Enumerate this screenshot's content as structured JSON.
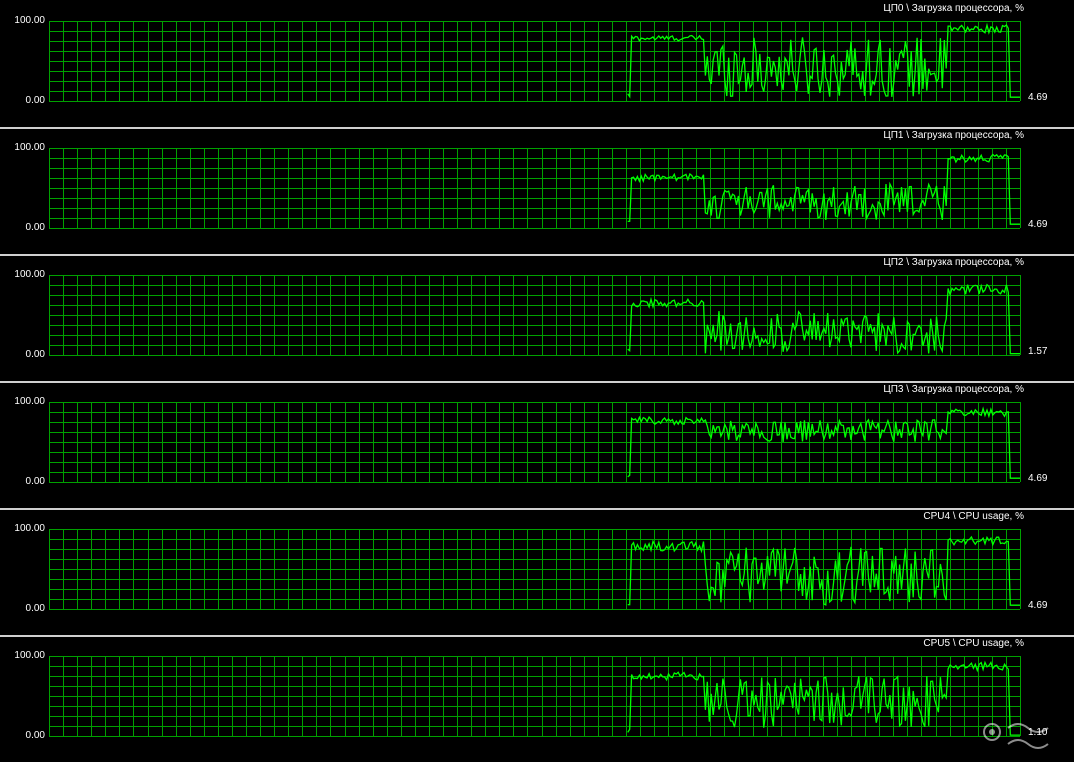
{
  "chart_data": [
    {
      "type": "line",
      "title": "ЦП0 \\ Загрузка процессора, %",
      "ylim": [
        0,
        100
      ],
      "ymax_label": "100.00",
      "ymin_label": "0.00",
      "current_value": "4.69",
      "series": [
        {
          "values": [
            5,
            5,
            5,
            5,
            5,
            5,
            5,
            5,
            5,
            5,
            5,
            5,
            5,
            5,
            5,
            5,
            5,
            5,
            5,
            5,
            5,
            5,
            5,
            5,
            5,
            5,
            5,
            5,
            5,
            5,
            5,
            5,
            5,
            5,
            5,
            5,
            5,
            5,
            5,
            5,
            5,
            5,
            5,
            5,
            5,
            5,
            5,
            5,
            5,
            5,
            5,
            5,
            5,
            5,
            5,
            5,
            5,
            5,
            5,
            5,
            5,
            5,
            5,
            5,
            5,
            5,
            5,
            5,
            5,
            5,
            5,
            5,
            5,
            5,
            5,
            5,
            5,
            5,
            5,
            5,
            5,
            5,
            5,
            5,
            5,
            5,
            5,
            5,
            5,
            5,
            5,
            5,
            5,
            5,
            5,
            5,
            5,
            5,
            5,
            5,
            5,
            5,
            5,
            5,
            5,
            5,
            5,
            5,
            5,
            5,
            5,
            5,
            5,
            5,
            5,
            5,
            5,
            5,
            5,
            5,
            5,
            5,
            5,
            5,
            5,
            5,
            5,
            5,
            5,
            5,
            5,
            5,
            5,
            5,
            5,
            5,
            5,
            5,
            5,
            5,
            5,
            5,
            5,
            5,
            5,
            5,
            5,
            5,
            5,
            5,
            5,
            5,
            5,
            5,
            5,
            5,
            5,
            5,
            5,
            5,
            5,
            5,
            5,
            5,
            5,
            5,
            5,
            5,
            5,
            5,
            5,
            5,
            5,
            5,
            5,
            5,
            5,
            5,
            5,
            5,
            5,
            5,
            5,
            5,
            5,
            5,
            5,
            5,
            5,
            5,
            5,
            5,
            5,
            5,
            5,
            5,
            5,
            5,
            5,
            5,
            5,
            5,
            5,
            5,
            5,
            5,
            5,
            5,
            5,
            5,
            5,
            5,
            5,
            5,
            5,
            5,
            5,
            5,
            5,
            5,
            5,
            5,
            5,
            5,
            5,
            5,
            5,
            5,
            5,
            5,
            5,
            5,
            5,
            5,
            5,
            5,
            5,
            5,
            5,
            5,
            5,
            5,
            5,
            5,
            5,
            5,
            5,
            5,
            5,
            5,
            5,
            5,
            5,
            5,
            5,
            5,
            5,
            5,
            5,
            5,
            5,
            5,
            5,
            5,
            5,
            5,
            5,
            5,
            5,
            5,
            5,
            5,
            5,
            5,
            5,
            5,
            5,
            5,
            5,
            5,
            5,
            5,
            5,
            5,
            5,
            5,
            5,
            5,
            5,
            5,
            5,
            5,
            5,
            5,
            5,
            5,
            5,
            5,
            5,
            5,
            5,
            5,
            5,
            5,
            5,
            5,
            5,
            5,
            5,
            5,
            5,
            5,
            5,
            5,
            5,
            5,
            5,
            5,
            5,
            5,
            5,
            5,
            5,
            5,
            5,
            5,
            5,
            5,
            5,
            5,
            5,
            5,
            5,
            5,
            5,
            5,
            5,
            5,
            5,
            5,
            5,
            5,
            5,
            5,
            5,
            5,
            5,
            5,
            5,
            5,
            5,
            5,
            5,
            5,
            5,
            5,
            5,
            5,
            5,
            5,
            5,
            5,
            5,
            5,
            5,
            5,
            5,
            5,
            5,
            5,
            5,
            5,
            5,
            5,
            5,
            5,
            5,
            5,
            5,
            5,
            5,
            5,
            5,
            5,
            5,
            5,
            5,
            5,
            5,
            5,
            5,
            5,
            5,
            5,
            5,
            5,
            5,
            5,
            5,
            5,
            5,
            5,
            5,
            5,
            5,
            5,
            5,
            5,
            5,
            5,
            5,
            5,
            5,
            5,
            5,
            5,
            5,
            5,
            5,
            5,
            5,
            5,
            5,
            5,
            5,
            5,
            5,
            5,
            5,
            5,
            5,
            5,
            5,
            5,
            5,
            5,
            5,
            5,
            5,
            5,
            5,
            5,
            5,
            5,
            5,
            5,
            5,
            5,
            5,
            5,
            5,
            5,
            5,
            5,
            5,
            5,
            5,
            5,
            5,
            5,
            5,
            5,
            5,
            5,
            5,
            5,
            5,
            5,
            5,
            5,
            5,
            5,
            5,
            5,
            5,
            5,
            5,
            5,
            5,
            5,
            5,
            5,
            5,
            5,
            5,
            5,
            5,
            5,
            5,
            5,
            5,
            5,
            5,
            5,
            5,
            5,
            5,
            5,
            5,
            5,
            5,
            5,
            5,
            5,
            5,
            5,
            5,
            5,
            5,
            5,
            5,
            5,
            5,
            5,
            5,
            5,
            5,
            5,
            5,
            5,
            5,
            5,
            5,
            5,
            5,
            5,
            5,
            5,
            5,
            5,
            5,
            5,
            5,
            5,
            5,
            5,
            5,
            5,
            5,
            5,
            5,
            5,
            5,
            5,
            5,
            5,
            5,
            5,
            5,
            5,
            5,
            5,
            5,
            5,
            5,
            5,
            5,
            5,
            5,
            5,
            5,
            5,
            5,
            5,
            5,
            5,
            5,
            5,
            5,
            5,
            5,
            5,
            5,
            5,
            5,
            5,
            5,
            5,
            5,
            5,
            5,
            5,
            5,
            5,
            5,
            5,
            5,
            5,
            5,
            5,
            5,
            5,
            5,
            5,
            5,
            5,
            5,
            5,
            5,
            5,
            5,
            5,
            5,
            5,
            5,
            5,
            5,
            5,
            5,
            5,
            5,
            5,
            5,
            5,
            5,
            5,
            5,
            5,
            5,
            5,
            5,
            5,
            5,
            5,
            5,
            5,
            5,
            5,
            5,
            5,
            5,
            5,
            5,
            5,
            5,
            5,
            5,
            5,
            5,
            5,
            5,
            5,
            5,
            5,
            5,
            5,
            5,
            5,
            5,
            5,
            5,
            5,
            5,
            5,
            5,
            5,
            5,
            5,
            5,
            5,
            5,
            5,
            5,
            5,
            5,
            5,
            5,
            5,
            5,
            5,
            5,
            5,
            5,
            5,
            5,
            5,
            5,
            5,
            5,
            5,
            5,
            5,
            5,
            5,
            5,
            5,
            5,
            5,
            5,
            5,
            5,
            5,
            5,
            5,
            5,
            5,
            5,
            5,
            5,
            5,
            5,
            5,
            5,
            5,
            5,
            5,
            5,
            5,
            5,
            5,
            5,
            5,
            5,
            5,
            5,
            5,
            5,
            5,
            5,
            5,
            5,
            5,
            5,
            5,
            5,
            5,
            5,
            5,
            5,
            5,
            5,
            5,
            5,
            5,
            5,
            5,
            5,
            5,
            5,
            5,
            5,
            5,
            5,
            5,
            5,
            5,
            5,
            5,
            5,
            5,
            5,
            5,
            5,
            5,
            5,
            5,
            5,
            5,
            5,
            5,
            5,
            5,
            5,
            5,
            5,
            5,
            5,
            5,
            5,
            5,
            5,
            5,
            5,
            5,
            5,
            5,
            5,
            5,
            5,
            5,
            5,
            5,
            5,
            5,
            5,
            5,
            5,
            5,
            5,
            5,
            5,
            5,
            5,
            5,
            5,
            5,
            5,
            5,
            5,
            5,
            5,
            5,
            5,
            5,
            5,
            5,
            5,
            5,
            5,
            5,
            5,
            5,
            5,
            5,
            5,
            5,
            5,
            5,
            5,
            5,
            5,
            5,
            5,
            5,
            5,
            5,
            5,
            5,
            5,
            5,
            5,
            5,
            5,
            5,
            5,
            5,
            5,
            5,
            5,
            5,
            5,
            5,
            5,
            5,
            5,
            5,
            5,
            5,
            5,
            5,
            5,
            5,
            5,
            5,
            5,
            5,
            5,
            5,
            5,
            5,
            5,
            5,
            5,
            5,
            5,
            5,
            5,
            5,
            5,
            5,
            5,
            5,
            5,
            5,
            5,
            5,
            5,
            5,
            5,
            5,
            5,
            5,
            5,
            5,
            5,
            5,
            5,
            5,
            5,
            5,
            5,
            5,
            5,
            5,
            5,
            5,
            5,
            5,
            5,
            5,
            5,
            5,
            5,
            5,
            5,
            5,
            5,
            5,
            5,
            5,
            5,
            5,
            5,
            5,
            5,
            5,
            5,
            5,
            5,
            5,
            5,
            5,
            5,
            5,
            5,
            5,
            5,
            5,
            5,
            5,
            5,
            5,
            5,
            5,
            5,
            5,
            5,
            5,
            5,
            5,
            5,
            5,
            5,
            5,
            5,
            5,
            5,
            5,
            5,
            5,
            5,
            5,
            5,
            5,
            5,
            5,
            5,
            5,
            5,
            5,
            5,
            5,
            5,
            5,
            5,
            5,
            5,
            5,
            5,
            5,
            5,
            5,
            5,
            5,
            5,
            5,
            5,
            5,
            5,
            5,
            5,
            5,
            5,
            5,
            5,
            5,
            5,
            5,
            5,
            5,
            5,
            5,
            5,
            5,
            5,
            5,
            5,
            5,
            5,
            5,
            5,
            5,
            5,
            5,
            5,
            5,
            5,
            5,
            5,
            5,
            5,
            5,
            5,
            5,
            5,
            5,
            5,
            5,
            5,
            5,
            5,
            5,
            5,
            5,
            5,
            5
          ]
        }
      ],
      "profile": {
        "start": 0.595,
        "s1_end": 0.675,
        "s1": [
          75,
          82
        ],
        "s2_end": 0.925,
        "s2": [
          5,
          80
        ],
        "s3": [
          85,
          95
        ],
        "end": 0.99,
        "tail": 4.69
      }
    },
    {
      "type": "line",
      "title": "ЦП1 \\ Загрузка процессора, %",
      "ylim": [
        0,
        100
      ],
      "ymax_label": "100.00",
      "ymin_label": "0.00",
      "current_value": "4.69",
      "profile": {
        "start": 0.595,
        "s1_end": 0.675,
        "s1": [
          58,
          68
        ],
        "s2_end": 0.925,
        "s2": [
          10,
          55
        ],
        "s3": [
          82,
          92
        ],
        "end": 0.99,
        "tail": 4.69
      }
    },
    {
      "type": "line",
      "title": "ЦП2 \\ Загрузка процессора, %",
      "ylim": [
        0,
        100
      ],
      "ymax_label": "100.00",
      "ymin_label": "0.00",
      "current_value": "1.57",
      "profile": {
        "start": 0.595,
        "s1_end": 0.675,
        "s1": [
          60,
          70
        ],
        "s2_end": 0.925,
        "s2": [
          2,
          55
        ],
        "s3": [
          75,
          88
        ],
        "end": 0.99,
        "tail": 1.57
      }
    },
    {
      "type": "line",
      "title": "ЦП3 \\ Загрузка процессора, %",
      "ylim": [
        0,
        100
      ],
      "ymax_label": "100.00",
      "ymin_label": "0.00",
      "current_value": "4.69",
      "profile": {
        "start": 0.595,
        "s1_end": 0.675,
        "s1": [
          72,
          82
        ],
        "s2_end": 0.925,
        "s2": [
          50,
          78
        ],
        "s3": [
          82,
          92
        ],
        "end": 0.99,
        "tail": 4.69
      }
    },
    {
      "type": "line",
      "title": "CPU4 \\ CPU usage, %",
      "ylim": [
        0,
        100
      ],
      "ymax_label": "100.00",
      "ymin_label": "0.00",
      "current_value": "4.69",
      "profile": {
        "start": 0.595,
        "s1_end": 0.675,
        "s1": [
          72,
          85
        ],
        "s2_end": 0.925,
        "s2": [
          5,
          78
        ],
        "s3": [
          80,
          90
        ],
        "end": 0.99,
        "tail": 4.69
      }
    },
    {
      "type": "line",
      "title": "CPU5 \\ CPU usage, %",
      "ylim": [
        0,
        100
      ],
      "ymax_label": "100.00",
      "ymin_label": "0.00",
      "current_value": "1.10",
      "profile": {
        "start": 0.595,
        "s1_end": 0.675,
        "s1": [
          70,
          80
        ],
        "s2_end": 0.925,
        "s2": [
          10,
          75
        ],
        "s3": [
          82,
          92
        ],
        "end": 0.99,
        "tail": 1.1
      }
    }
  ],
  "colors": {
    "grid": "#00a000",
    "line": "#00ff00",
    "background": "#000000",
    "separator": "#cfcfcf"
  }
}
